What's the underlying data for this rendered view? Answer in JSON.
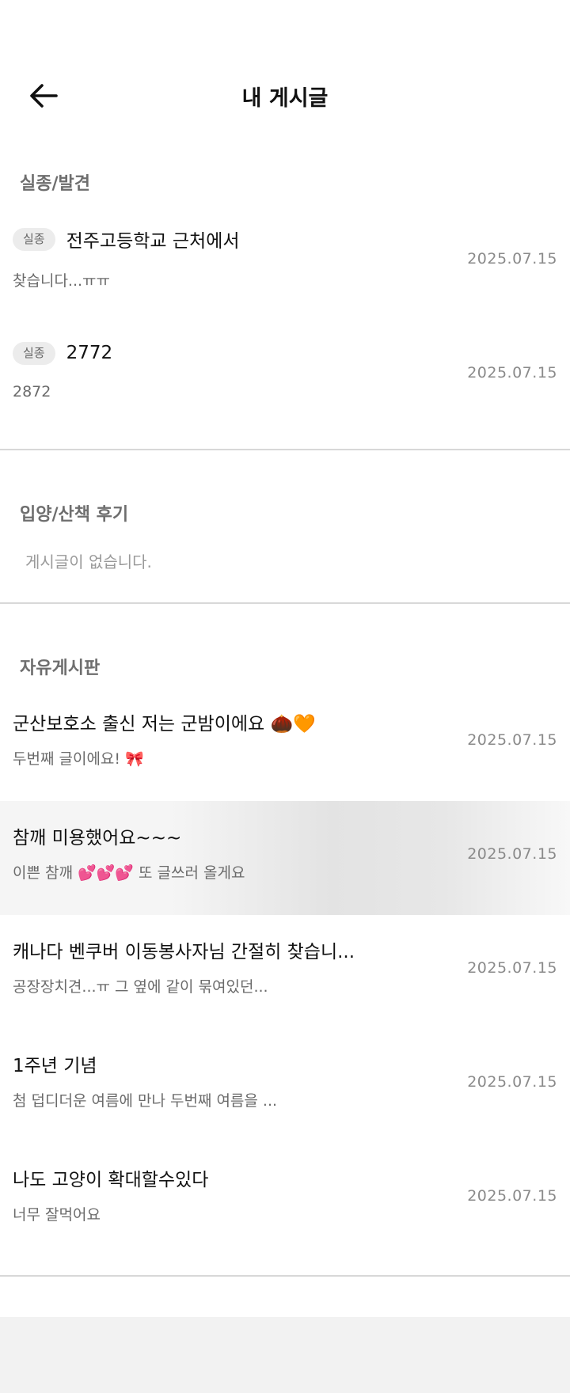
{
  "header": {
    "title": "내 게시글",
    "back_icon": "arrow-left-icon"
  },
  "sections": {
    "lost_found": {
      "title": "실종/발견",
      "posts": [
        {
          "badge": "실종",
          "title": "전주고등학교 근처에서",
          "subtitle": "찾습니다...ㅠㅠ",
          "date": "2025.07.15"
        },
        {
          "badge": "실종",
          "title": "2772",
          "subtitle": "2872",
          "date": "2025.07.15"
        }
      ]
    },
    "adoption_review": {
      "title": "입양/산책 후기",
      "empty_message": "게시글이 없습니다."
    },
    "free_board": {
      "title": "자유게시판",
      "posts": [
        {
          "title": "군산보호소 출신 저는 군밤이에요 🌰🧡",
          "subtitle": "두번째 글이에요! 🎀",
          "date": "2025.07.15"
        },
        {
          "title": "참깨 미용했어요~~~",
          "subtitle": "이쁜 참깨 💕💕💕 또 글쓰러 올게요",
          "date": "2025.07.15"
        },
        {
          "title": "캐나다 벤쿠버 이동봉사자님 간절히 찾습니...",
          "subtitle": "공장장치견...ㅠ 그 옆에 같이 묶여있던...",
          "date": "2025.07.15"
        },
        {
          "title": "1주년 기념",
          "subtitle": "첨 덥디더운 여름에 만나 두번째 여름을 ...",
          "date": "2025.07.15"
        },
        {
          "title": "나도 고양이 확대할수있다",
          "subtitle": "너무 잘먹어요",
          "date": "2025.07.15"
        }
      ]
    }
  }
}
